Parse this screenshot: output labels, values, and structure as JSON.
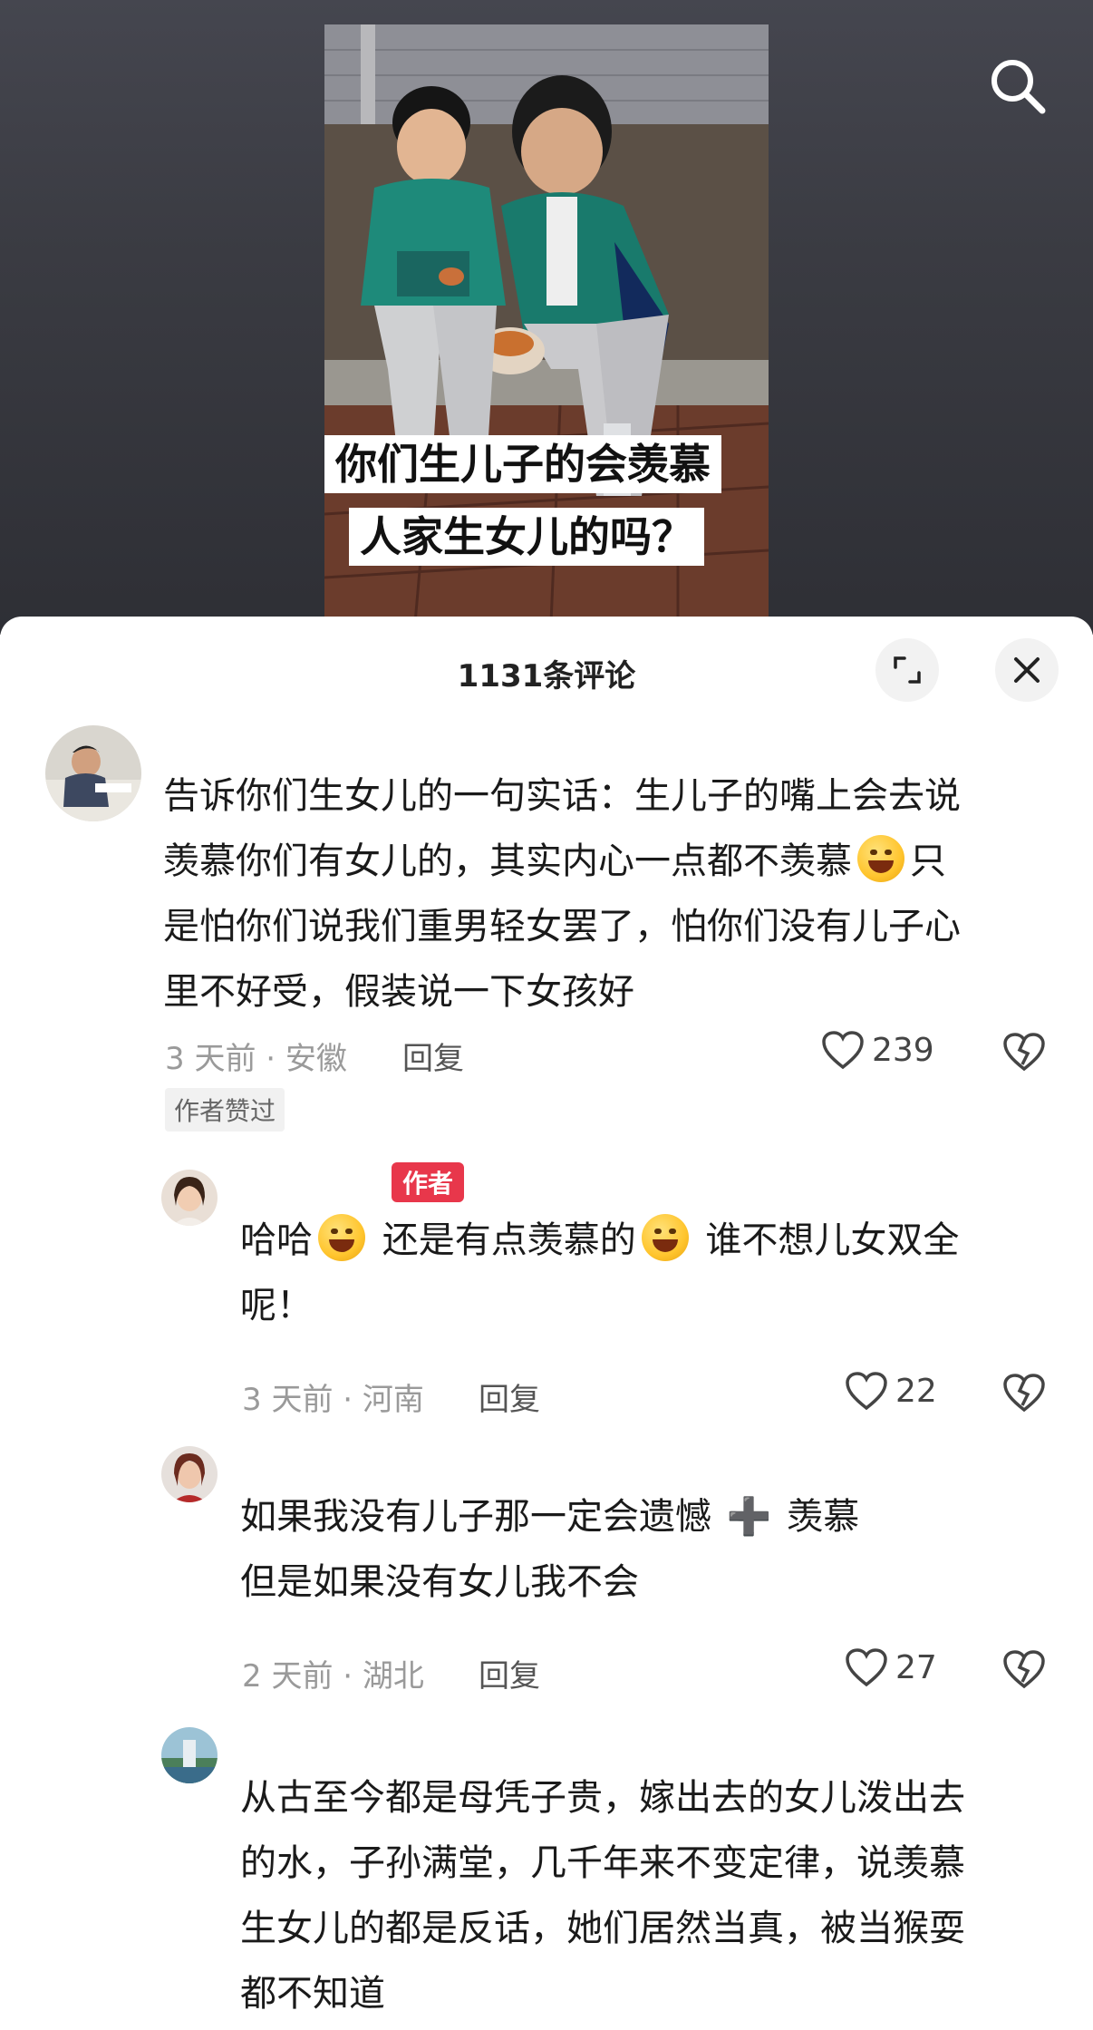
{
  "video": {
    "caption_line1": "你们生儿子的会羡慕",
    "caption_line2": "人家生女儿的吗？"
  },
  "icons": {
    "search": "search-icon",
    "expand": "expand-icon",
    "close": "close-icon"
  },
  "sheet": {
    "title": "1131条评论"
  },
  "comments": [
    {
      "text_lines": [
        "告诉你们生女儿的一句实话：生儿子的嘴上会去说",
        "羡慕你们有女儿的，其实内心一点都不羡慕",
        "只",
        "是怕你们说我们重男轻女罢了，怕你们没有儿子心",
        "里不好受，假装说一下女孩好"
      ],
      "meta": "3 天前 · 安徽",
      "reply": "回复",
      "likes": "239",
      "badge": "作者赞过"
    },
    {
      "author_tag": "作者",
      "text_part1": "哈哈",
      "text_part2": " 还是有点羡慕的",
      "text_part3": " 谁不想儿女双全",
      "text_line2": "呢！",
      "meta": "3 天前 · 河南",
      "reply": "回复",
      "likes": "22"
    },
    {
      "text_part1": "如果我没有儿子那一定会遗憾",
      "text_part2": "羡慕",
      "text_line2": "但是如果没有女儿我不会",
      "meta": "2 天前 · 湖北",
      "reply": "回复",
      "likes": "27"
    },
    {
      "text_lines": [
        "从古至今都是母凭子贵，嫁出去的女儿泼出去",
        "的水，子孙满堂，几千年来不变定律，说羡慕",
        "生女儿的都是反话，她们居然当真，被当猴耍",
        "都不知道"
      ]
    }
  ],
  "colors": {
    "author_tag": "#e8374b",
    "meta_text": "#9a9a9a"
  }
}
